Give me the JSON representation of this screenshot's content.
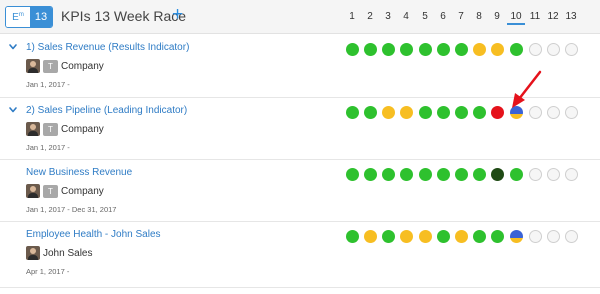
{
  "header": {
    "toggle_left": "E",
    "toggle_left_sup": "m",
    "toggle_right": "13",
    "title": "KPIs 13 Week Race",
    "add_label": "+",
    "weeks": [
      "1",
      "2",
      "3",
      "4",
      "5",
      "6",
      "7",
      "8",
      "9",
      "10",
      "11",
      "12",
      "13"
    ],
    "current_week": "10"
  },
  "colors": {
    "green": "#2ec12e",
    "yellow": "#f7be22",
    "red": "#e5121b",
    "darkgreen": "#1f4a14",
    "blue": "#3a63d6",
    "empty": "#f6f6f6",
    "link": "#2f7cc5",
    "accent": "#3a8fd6"
  },
  "kpis": [
    {
      "name": "1) Sales Revenue (Results Indicator)",
      "owner": "Company",
      "owner_tag": "T",
      "date": "Jan 1, 2017 -",
      "expandable": true,
      "statuses": [
        "green",
        "green",
        "green",
        "green",
        "green",
        "green",
        "green",
        "yellow",
        "yellow",
        "green",
        "empty",
        "empty",
        "empty"
      ]
    },
    {
      "name": "2) Sales Pipeline (Leading Indicator)",
      "owner": "Company",
      "owner_tag": "T",
      "date": "Jan 1, 2017 -",
      "expandable": true,
      "statuses": [
        "green",
        "green",
        "yellow",
        "yellow",
        "green",
        "green",
        "green",
        "green",
        "red",
        "split-blue-orange",
        "empty",
        "empty",
        "empty"
      ]
    },
    {
      "name": "New Business Revenue",
      "owner": "Company",
      "owner_tag": "T",
      "date": "Jan 1, 2017 - Dec 31, 2017",
      "expandable": false,
      "statuses": [
        "green",
        "green",
        "green",
        "green",
        "green",
        "green",
        "green",
        "green",
        "darkgreen",
        "green",
        "empty",
        "empty",
        "empty"
      ]
    },
    {
      "name": "Employee Health - John Sales",
      "owner": "John Sales",
      "owner_tag": "",
      "date": "Apr 1, 2017 -",
      "expandable": false,
      "statuses": [
        "green",
        "yellow",
        "green",
        "yellow",
        "yellow",
        "green",
        "yellow",
        "green",
        "green",
        "split-blue-orange",
        "empty",
        "empty",
        "empty"
      ]
    }
  ]
}
